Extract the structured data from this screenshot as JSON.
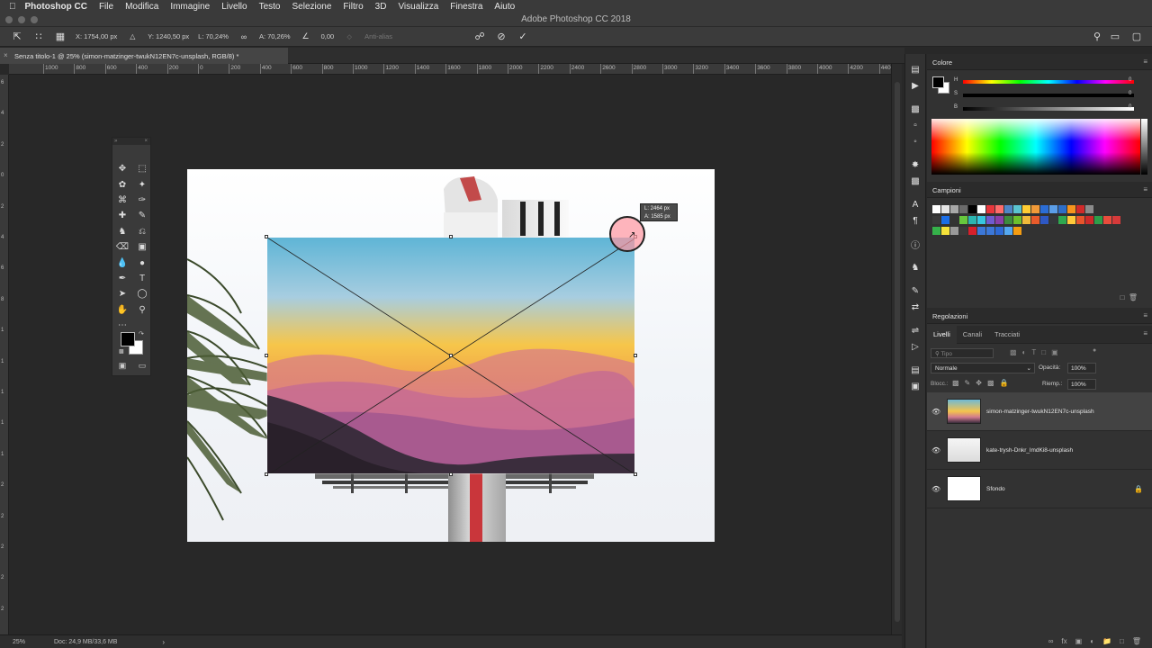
{
  "menubar": {
    "app": "Photoshop CC",
    "items": [
      "File",
      "Modifica",
      "Immagine",
      "Livello",
      "Testo",
      "Selezione",
      "Filtro",
      "3D",
      "Visualizza",
      "Finestra",
      "Aiuto"
    ]
  },
  "window_title": "Adobe Photoshop CC 2018",
  "options": {
    "x": "X: 1754,00 px",
    "y": "Y: 1240,50 px",
    "w": "L: 70,24%",
    "h": "A: 70,26%",
    "angle": "0,00",
    "antialias": "Anti-alias"
  },
  "document": {
    "tab": "Senza titolo-1 @ 25% (simon-matzinger-twukN12EN7c-unsplash, RGB/8) *"
  },
  "ruler": {
    "h_labels": [
      "1000",
      "800",
      "600",
      "400",
      "200",
      "0",
      "200",
      "400",
      "600",
      "800",
      "1000",
      "1200",
      "1400",
      "1600",
      "1800",
      "2000",
      "2200",
      "2400",
      "2600",
      "2800",
      "3000",
      "3200",
      "3400",
      "3600",
      "3800",
      "4000",
      "4200",
      "4400",
      "460"
    ],
    "v_labels": [
      "6",
      "4",
      "2",
      "0",
      "2",
      "4",
      "6",
      "8",
      "1",
      "1",
      "1",
      "1",
      "1",
      "2",
      "2",
      "2",
      "2",
      "2"
    ]
  },
  "readout": {
    "w": "L: 2464 px",
    "h": "A: 1585 px"
  },
  "status": {
    "zoom": "25%",
    "doc": "Doc: 24,9 MB/33,6 MB",
    "arrow": "›"
  },
  "colore": {
    "title": "Colore",
    "sliders": [
      {
        "label": "H",
        "value": "0",
        "unit": "°"
      },
      {
        "label": "S",
        "value": "0",
        "unit": "%"
      },
      {
        "label": "B",
        "value": "0",
        "unit": "%"
      }
    ]
  },
  "campioni": {
    "title": "Campioni",
    "row1": [
      "#ffffff",
      "#e6e6e6",
      "#a8a8a8",
      "#6b6b6b",
      "#000000",
      "#ffffff",
      "#e8363c",
      "#ff6b6b",
      "#4f86c6",
      "#5ac4d0",
      "#ffcc33",
      "#f19a38",
      "#2b6dd6",
      "#5b9ee8",
      "#2e6ec7",
      "#f7941d",
      "#d12a2a",
      "#8c8c8c"
    ],
    "row2": [
      "#3a3a3a",
      "#1b6ee6",
      "#333333",
      "#67c73d",
      "#2bb5b0",
      "#37c6e0",
      "#6f5bcf",
      "#8a3fa8",
      "#3d8b3d",
      "#6cbf2d",
      "#f0b93a",
      "#e85b2b",
      "#2e58c4",
      "#34373a",
      "#2fa84f",
      "#ffc93a",
      "#e8542b",
      "#cc2a2a",
      "#2d9e4a",
      "#e84c3c",
      "#d63a3a"
    ],
    "row3": [
      "#35b24a",
      "#f5e23a",
      "#9a9a9a",
      "#3a3a3a",
      "#d6202c",
      "#3c78d8",
      "#3c78d8",
      "#2d6ad6",
      "#55a8f0",
      "#f39c12"
    ]
  },
  "regolazioni": {
    "title": "Regolazioni"
  },
  "layers": {
    "tabs": [
      "Livelli",
      "Canali",
      "Tracciati"
    ],
    "filter_placeholder": "Tipo",
    "blend_mode": "Normale",
    "opacity_label": "Opacità:",
    "opacity": "100%",
    "lock_label": "Blocc.:",
    "fill_label": "Riemp.:",
    "fill": "100%",
    "items": [
      {
        "name": "simon-matzinger-twukN12EN7c-unsplash"
      },
      {
        "name": "kate-trysh-Dnkr_lmdKi8-unsplash"
      },
      {
        "name": "Sfondo"
      }
    ]
  }
}
